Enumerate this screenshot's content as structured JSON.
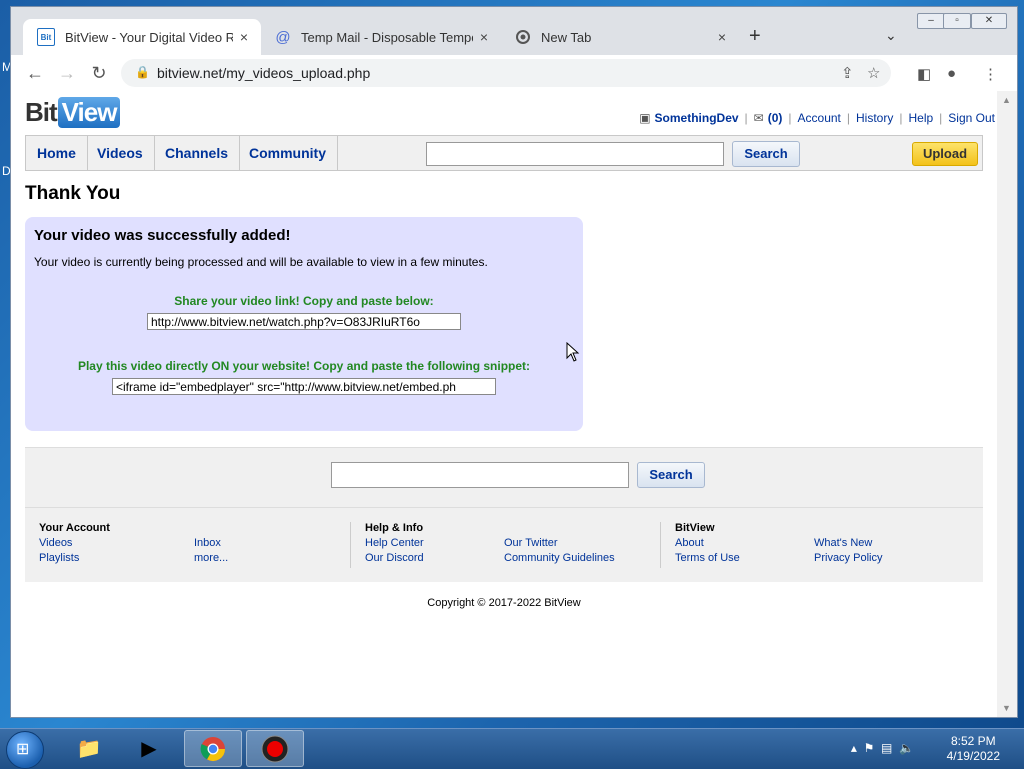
{
  "desktop": {
    "glyph_m": "M",
    "glyph_d": "D"
  },
  "browser": {
    "tabs": [
      {
        "title": "BitView - Your Digital Video Repo",
        "icon": "bitview-favicon",
        "active": true
      },
      {
        "title": "Temp Mail - Disposable Tempora",
        "icon": "at-sign-icon",
        "active": false
      },
      {
        "title": "New Tab",
        "icon": "chrome-icon",
        "active": false
      }
    ],
    "close_glyph": "×",
    "newtab_glyph": "+",
    "url": "bitview.net/my_videos_upload.php"
  },
  "site": {
    "logo_bit": "Bit",
    "logo_view": "View",
    "user": {
      "username": "SomethingDev",
      "inbox_count": "(0)",
      "links": [
        "Account",
        "History",
        "Help",
        "Sign Out"
      ]
    },
    "nav": [
      "Home",
      "Videos",
      "Channels",
      "Community"
    ],
    "search_label": "Search",
    "upload_label": "Upload",
    "search_value": ""
  },
  "main": {
    "heading": "Thank You",
    "success_title": "Your video was successfully added!",
    "processing_text": "Your video is currently being processed and will be available to view in a few minutes.",
    "share_label": "Share your video link! Copy and paste below:",
    "share_value": "http://www.bitview.net/watch.php?v=O83JRIuRT6o",
    "embed_label": "Play this video directly ON your website! Copy and paste the following snippet:",
    "embed_value": "<iframe id=\"embedplayer\" src=\"http://www.bitview.net/embed.ph"
  },
  "footer": {
    "search_label": "Search",
    "your_account": {
      "title": "Your Account",
      "links": [
        "Videos",
        "Playlists",
        "Inbox",
        "more..."
      ]
    },
    "help_info": {
      "title": "Help & Info",
      "links": [
        "Help Center",
        "Our Discord",
        "Our Twitter",
        "Community Guidelines"
      ]
    },
    "bitview": {
      "title": "BitView",
      "links": [
        "About",
        "Terms of Use",
        "What's New",
        "Privacy Policy"
      ]
    },
    "copyright": "Copyright © 2017-2022 BitView"
  },
  "taskbar": {
    "time": "8:52 PM",
    "date": "4/19/2022"
  }
}
